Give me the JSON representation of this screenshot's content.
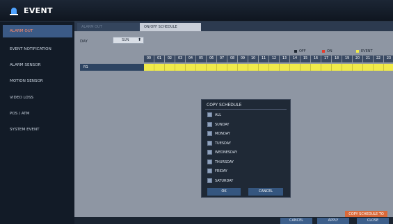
{
  "window": {
    "title": "EVENT"
  },
  "sidebar": {
    "items": [
      {
        "label": "ALARM OUT",
        "active": true
      },
      {
        "label": "EVENT NOTIFICATION",
        "active": false
      },
      {
        "label": "ALARM SENSOR",
        "active": false
      },
      {
        "label": "MOTION SENSOR",
        "active": false
      },
      {
        "label": "VIDEO LOSS",
        "active": false
      },
      {
        "label": "POS / ATM",
        "active": false
      },
      {
        "label": "SYSTEM EVENT",
        "active": false
      }
    ]
  },
  "tabs": [
    {
      "label": "ALARM OUT",
      "active": false
    },
    {
      "label": "ON/OFF SCHEDULE",
      "active": true
    }
  ],
  "schedule": {
    "day_label": "DAY",
    "day_value": "SUN",
    "legend": {
      "off": "OFF",
      "on": "ON",
      "event": "EVENT"
    },
    "legend_colors": {
      "off": "#1e2733",
      "on": "#e53b2c",
      "event": "#f0ea4a"
    },
    "hours": [
      "00",
      "01",
      "02",
      "03",
      "04",
      "05",
      "06",
      "07",
      "08",
      "09",
      "10",
      "11",
      "12",
      "13",
      "14",
      "15",
      "16",
      "17",
      "18",
      "19",
      "20",
      "21",
      "22",
      "23"
    ],
    "row_label": "R1",
    "cell_state": "EVENT"
  },
  "dialog": {
    "title": "COPY SCHEDULE",
    "options": [
      "ALL",
      "SUNDAY",
      "MONDAY",
      "TUESDAY",
      "WEDNESDAY",
      "THURSDAY",
      "FRIDAY",
      "SATURDAY"
    ],
    "ok": "OK",
    "cancel": "CANCEL"
  },
  "actions": {
    "copy_schedule": "COPY SCHEDULE TO",
    "cancel": "CANCEL",
    "apply": "APPLY",
    "close": "CLOSE"
  }
}
